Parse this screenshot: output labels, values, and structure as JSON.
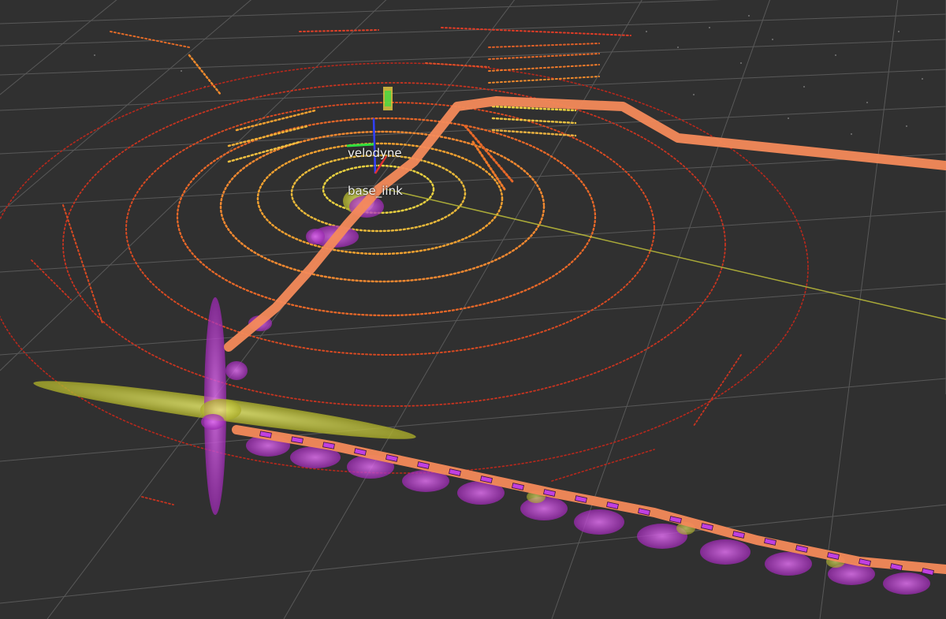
{
  "viewer": {
    "background_color": "#303030",
    "grid_color": "#8a8a8a"
  },
  "frames": {
    "velodyne": "velodyne",
    "base_link": "base_iink"
  },
  "colors": {
    "path": "#f48a5a",
    "covariance_xy": "#c8d040",
    "covariance_z": "#b040c8",
    "odometry_marker": "#d040e0",
    "scan_near": "#e8d040",
    "scan_mid": "#f08030",
    "scan_far": "#d03020",
    "axis_x": "#e03030",
    "axis_y": "#30e040",
    "axis_z": "#3040ff"
  }
}
